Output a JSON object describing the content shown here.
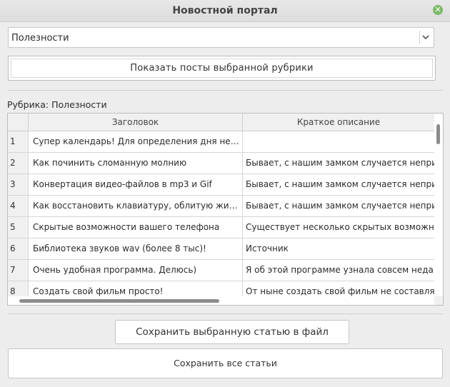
{
  "window": {
    "title": "Новостной портал"
  },
  "category_select": {
    "value": "Полезности"
  },
  "buttons": {
    "show_posts": "Показать посты выбранной рубрики",
    "save_selected": "Сохранить выбранную статью в файл",
    "save_all": "Сохранить все статьи"
  },
  "rubric_label": "Рубрика: Полезности",
  "table": {
    "headers": [
      "Заголовок",
      "Краткое описание"
    ],
    "rows": [
      {
        "n": "1",
        "title": "Супер календарь! Для определения дня недел...",
        "desc": ""
      },
      {
        "n": "2",
        "title": "Как починить сломанную молнию",
        "desc": "Бывает, с нашим замком случается неприятн"
      },
      {
        "n": "3",
        "title": "Конвертация видео-файлов в mp3 и Gif",
        "desc": "Бывает, с нашим замком случается неприятн"
      },
      {
        "n": "4",
        "title": "Как восстановить клавиатуру, облитую жидкос...",
        "desc": "Бывает, с нашим замком случается неприятн"
      },
      {
        "n": "5",
        "title": "Скрытые возможности вашего телефона",
        "desc": "Существует несколько скрытых возможносте"
      },
      {
        "n": "6",
        "title": "Библиотека звуков wav (более 8 тыс)!",
        "desc": "Источник"
      },
      {
        "n": "7",
        "title": "Очень удобная программа. Делюсь)",
        "desc": "Я об этой программе узнала совсем недавно"
      },
      {
        "n": "8",
        "title": "Создать свой фильм просто!",
        "desc": "От  ныне создать свой фильм не составляет"
      }
    ]
  }
}
